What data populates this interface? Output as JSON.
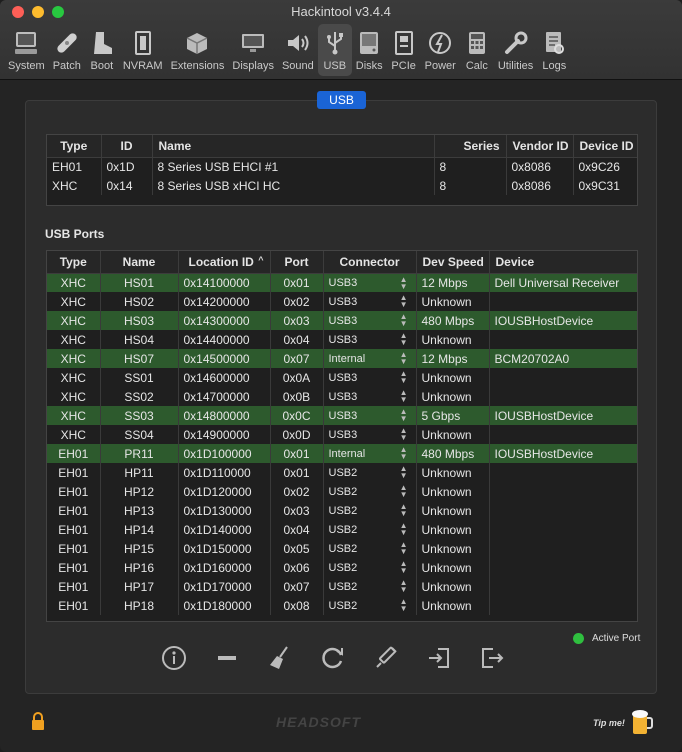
{
  "window": {
    "title": "Hackintool v3.4.4"
  },
  "toolbar": [
    {
      "label": "System",
      "icon": "computer-icon",
      "active": false
    },
    {
      "label": "Patch",
      "icon": "bandage-icon",
      "active": false
    },
    {
      "label": "Boot",
      "icon": "boot-icon",
      "active": false
    },
    {
      "label": "NVRAM",
      "icon": "nvram-icon",
      "active": false
    },
    {
      "label": "Extensions",
      "icon": "extensions-icon",
      "active": false
    },
    {
      "label": "Displays",
      "icon": "display-icon",
      "active": false
    },
    {
      "label": "Sound",
      "icon": "speaker-icon",
      "active": false
    },
    {
      "label": "USB",
      "icon": "usb-icon",
      "active": true
    },
    {
      "label": "Disks",
      "icon": "disk-icon",
      "active": false
    },
    {
      "label": "PCIe",
      "icon": "pcie-icon",
      "active": false
    },
    {
      "label": "Power",
      "icon": "power-icon",
      "active": false
    },
    {
      "label": "Calc",
      "icon": "calculator-icon",
      "active": false
    },
    {
      "label": "Utilities",
      "icon": "wrench-icon",
      "active": false
    },
    {
      "label": "Logs",
      "icon": "logs-icon",
      "active": false
    }
  ],
  "tab_label": "USB",
  "controllers": {
    "headers": [
      "Type",
      "ID",
      "Name",
      "Series",
      "Vendor ID",
      "Device ID"
    ],
    "rows": [
      [
        "EH01",
        "0x1D",
        "8 Series USB EHCI #1",
        "8",
        "0x8086",
        "0x9C26"
      ],
      [
        "XHC",
        "0x14",
        "8 Series USB xHCI HC",
        "8",
        "0x8086",
        "0x9C31"
      ]
    ]
  },
  "ports_label": "USB Ports",
  "ports": {
    "headers": [
      "Type",
      "Name",
      "Location ID",
      "Port",
      "Connector",
      "Dev Speed",
      "Device"
    ],
    "sort_indicator": "^",
    "rows": [
      {
        "type": "XHC",
        "name": "HS01",
        "location": "0x14100000",
        "port": "0x01",
        "connector": "USB3",
        "speed": "12 Mbps",
        "device": "Dell Universal Receiver",
        "active": true
      },
      {
        "type": "XHC",
        "name": "HS02",
        "location": "0x14200000",
        "port": "0x02",
        "connector": "USB3",
        "speed": "Unknown",
        "device": "",
        "active": false
      },
      {
        "type": "XHC",
        "name": "HS03",
        "location": "0x14300000",
        "port": "0x03",
        "connector": "USB3",
        "speed": "480 Mbps",
        "device": "IOUSBHostDevice",
        "active": true
      },
      {
        "type": "XHC",
        "name": "HS04",
        "location": "0x14400000",
        "port": "0x04",
        "connector": "USB3",
        "speed": "Unknown",
        "device": "",
        "active": false
      },
      {
        "type": "XHC",
        "name": "HS07",
        "location": "0x14500000",
        "port": "0x07",
        "connector": "Internal",
        "speed": "12 Mbps",
        "device": "BCM20702A0",
        "active": true
      },
      {
        "type": "XHC",
        "name": "SS01",
        "location": "0x14600000",
        "port": "0x0A",
        "connector": "USB3",
        "speed": "Unknown",
        "device": "",
        "active": false
      },
      {
        "type": "XHC",
        "name": "SS02",
        "location": "0x14700000",
        "port": "0x0B",
        "connector": "USB3",
        "speed": "Unknown",
        "device": "",
        "active": false
      },
      {
        "type": "XHC",
        "name": "SS03",
        "location": "0x14800000",
        "port": "0x0C",
        "connector": "USB3",
        "speed": "5 Gbps",
        "device": "IOUSBHostDevice",
        "active": true
      },
      {
        "type": "XHC",
        "name": "SS04",
        "location": "0x14900000",
        "port": "0x0D",
        "connector": "USB3",
        "speed": "Unknown",
        "device": "",
        "active": false
      },
      {
        "type": "EH01",
        "name": "PR11",
        "location": "0x1D100000",
        "port": "0x01",
        "connector": "Internal",
        "speed": "480 Mbps",
        "device": "IOUSBHostDevice",
        "active": true
      },
      {
        "type": "EH01",
        "name": "HP11",
        "location": "0x1D110000",
        "port": "0x01",
        "connector": "USB2",
        "speed": "Unknown",
        "device": "",
        "active": false
      },
      {
        "type": "EH01",
        "name": "HP12",
        "location": "0x1D120000",
        "port": "0x02",
        "connector": "USB2",
        "speed": "Unknown",
        "device": "",
        "active": false
      },
      {
        "type": "EH01",
        "name": "HP13",
        "location": "0x1D130000",
        "port": "0x03",
        "connector": "USB2",
        "speed": "Unknown",
        "device": "",
        "active": false
      },
      {
        "type": "EH01",
        "name": "HP14",
        "location": "0x1D140000",
        "port": "0x04",
        "connector": "USB2",
        "speed": "Unknown",
        "device": "",
        "active": false
      },
      {
        "type": "EH01",
        "name": "HP15",
        "location": "0x1D150000",
        "port": "0x05",
        "connector": "USB2",
        "speed": "Unknown",
        "device": "",
        "active": false
      },
      {
        "type": "EH01",
        "name": "HP16",
        "location": "0x1D160000",
        "port": "0x06",
        "connector": "USB2",
        "speed": "Unknown",
        "device": "",
        "active": false
      },
      {
        "type": "EH01",
        "name": "HP17",
        "location": "0x1D170000",
        "port": "0x07",
        "connector": "USB2",
        "speed": "Unknown",
        "device": "",
        "active": false
      },
      {
        "type": "EH01",
        "name": "HP18",
        "location": "0x1D180000",
        "port": "0x08",
        "connector": "USB2",
        "speed": "Unknown",
        "device": "",
        "active": false
      }
    ]
  },
  "legend": {
    "label": "Active Port",
    "color": "#2fbf3f"
  },
  "bottom_tools": [
    "info-icon",
    "minus-icon",
    "broom-icon",
    "refresh-icon",
    "syringe-icon",
    "import-icon",
    "export-icon"
  ],
  "footer": {
    "brand": "HEADSOFT",
    "tip": "Tip me!"
  },
  "colors": {
    "accent": "#1a64d6",
    "active_row": "#2d5a2d"
  }
}
